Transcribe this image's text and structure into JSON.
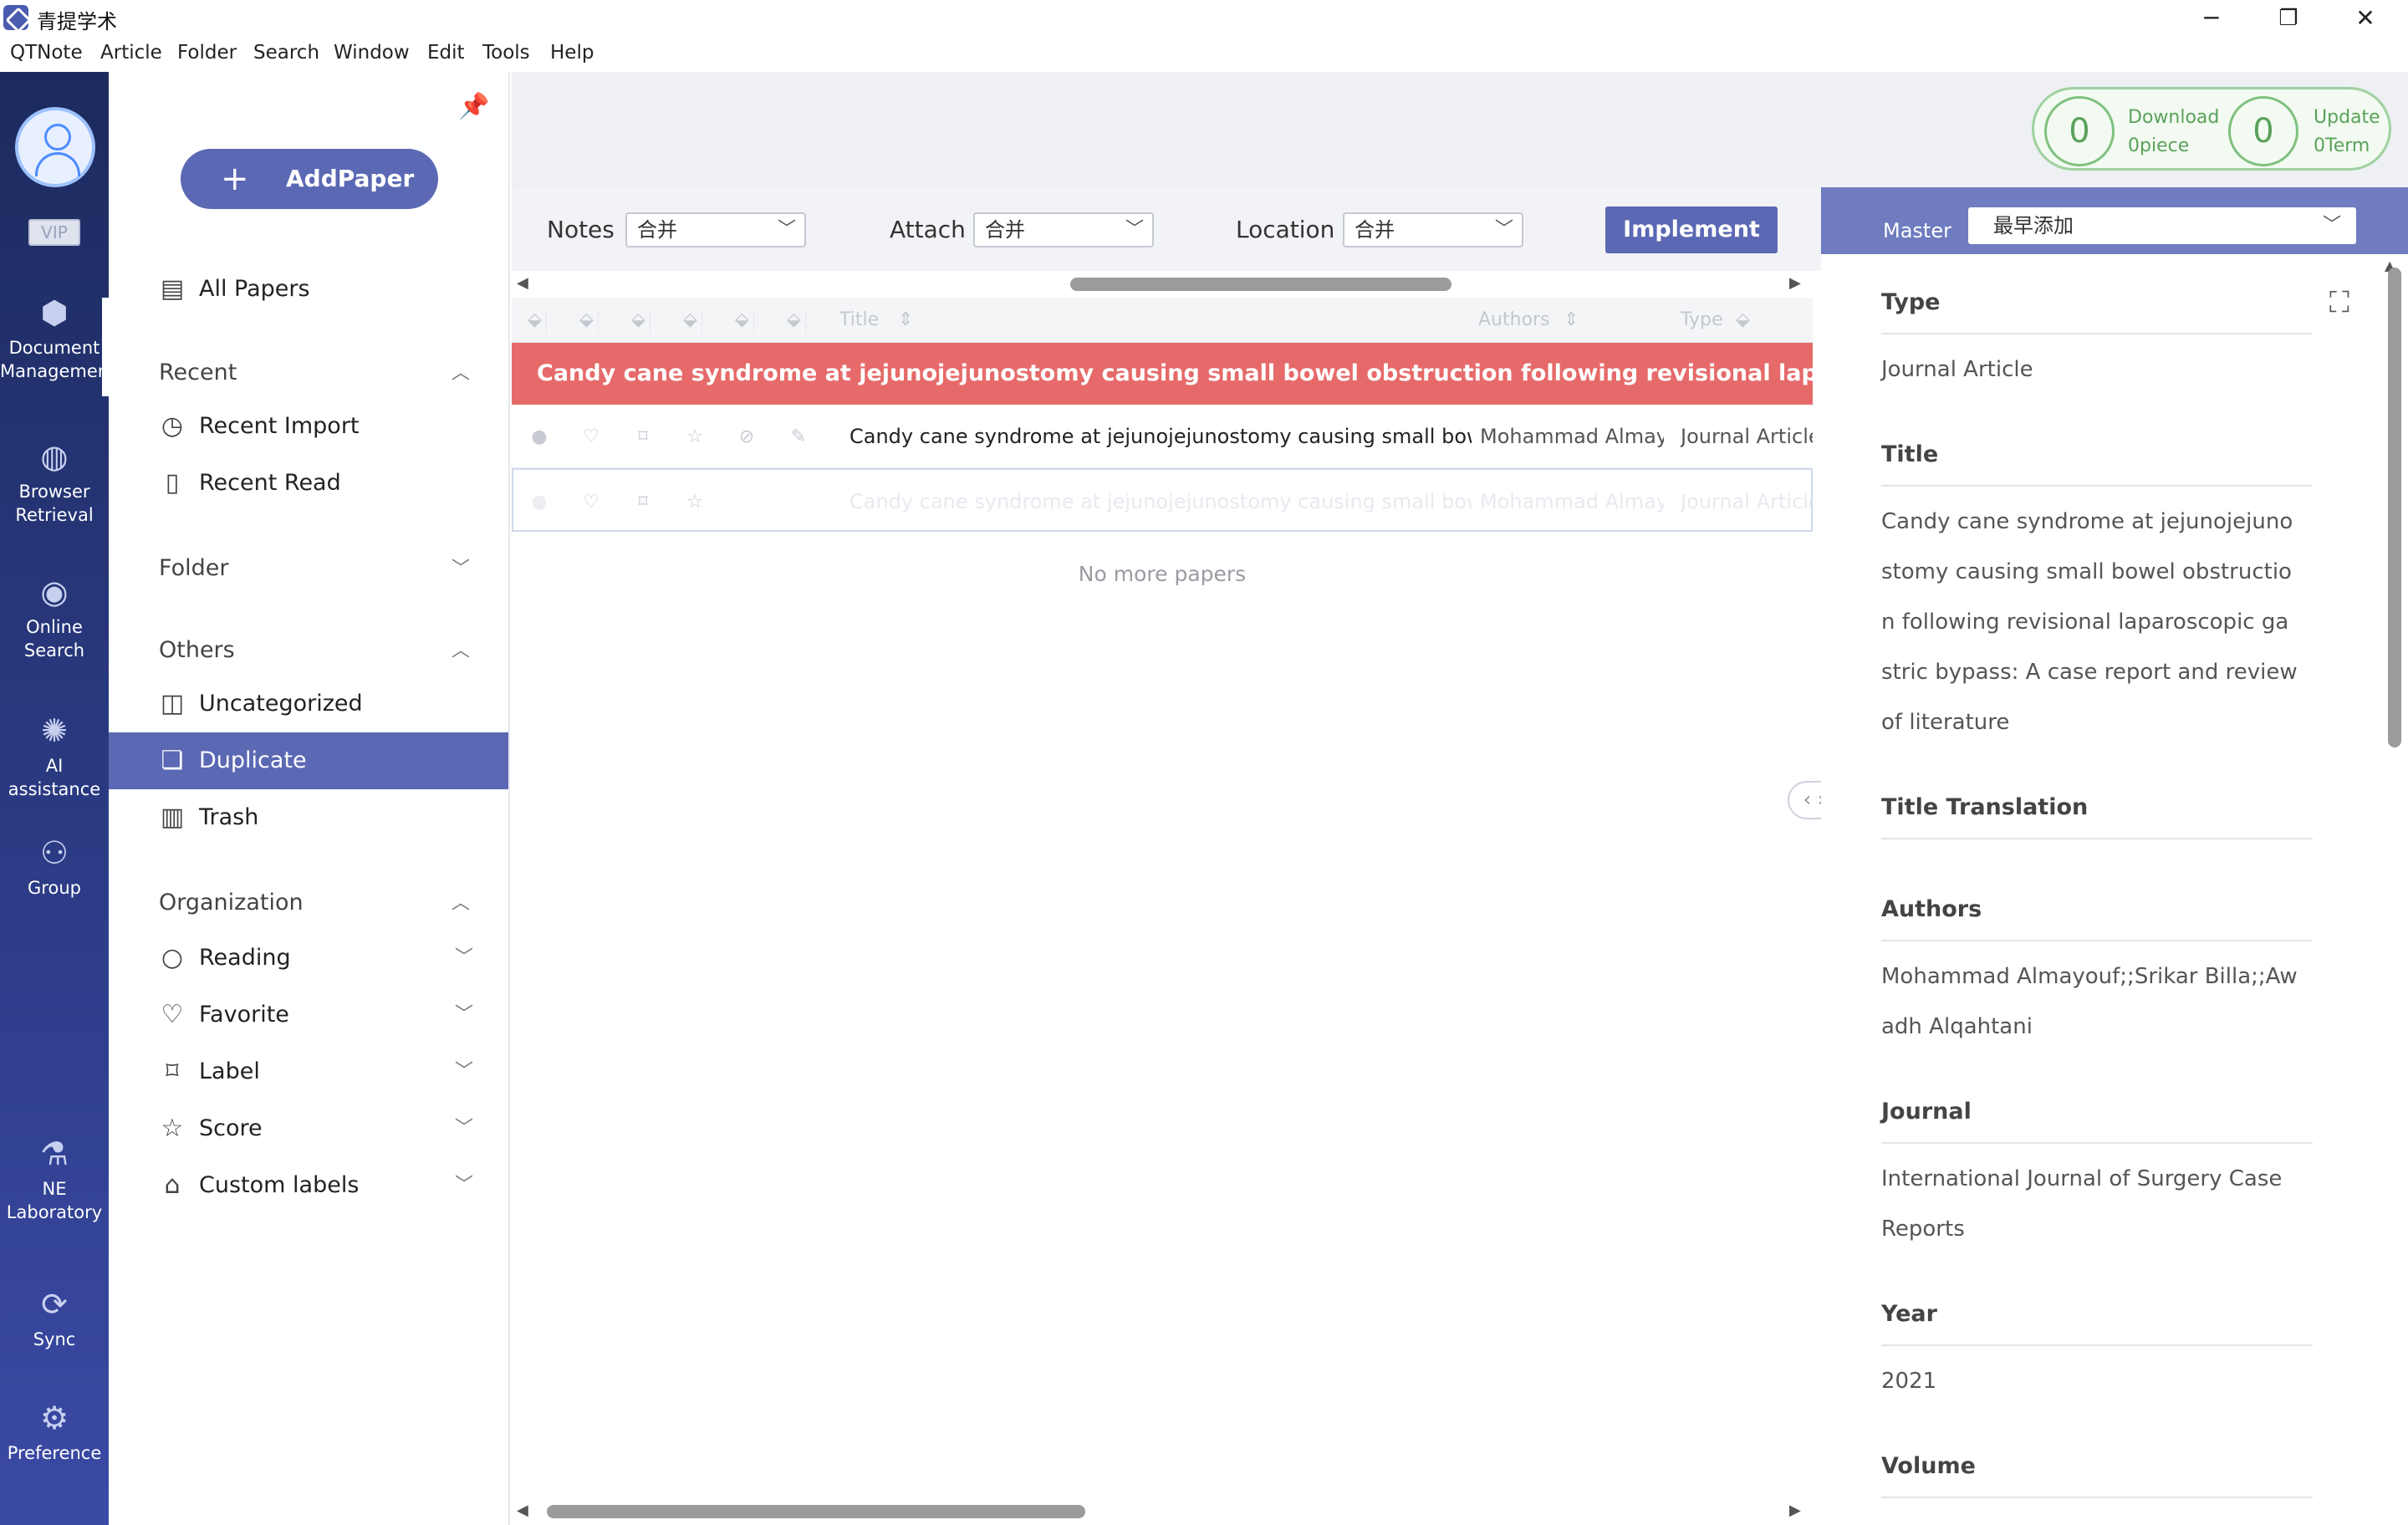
{
  "window": {
    "title": "青提学术",
    "minimize": "─",
    "maximize": "❐",
    "close": "✕"
  },
  "menu": [
    "QTNote",
    "Article",
    "Folder",
    "Search",
    "Window",
    "Edit",
    "Tools",
    "Help"
  ],
  "rail": {
    "vip": "VIP",
    "items": [
      {
        "label1": "Document",
        "label2": "Management",
        "icon": "cube-icon"
      },
      {
        "label1": "Browser",
        "label2": "Retrieval",
        "icon": "globe-icon"
      },
      {
        "label1": "Online",
        "label2": "Search",
        "icon": "eye-icon"
      },
      {
        "label1": "AI assistance",
        "label2": "",
        "icon": "ai-icon"
      },
      {
        "label1": "Group",
        "label2": "",
        "icon": "group-icon"
      },
      {
        "label1": "NE",
        "label2": "Laboratory",
        "icon": "microscope-icon"
      },
      {
        "label1": "Sync",
        "label2": "",
        "icon": "sync-icon"
      },
      {
        "label1": "Preference",
        "label2": "",
        "icon": "gear-icon"
      }
    ]
  },
  "sidebar": {
    "add_paper": "AddPaper",
    "all_papers": "All Papers",
    "recent": "Recent",
    "recent_import": "Recent Import",
    "recent_read": "Recent Read",
    "folder": "Folder",
    "others": "Others",
    "uncategorized": "Uncategorized",
    "duplicate": "Duplicate",
    "trash": "Trash",
    "organization": "Organization",
    "reading": "Reading",
    "favorite": "Favorite",
    "label": "Label",
    "score": "Score",
    "custom_labels": "Custom labels"
  },
  "filters": {
    "notes_label": "Notes",
    "notes_value": "合并",
    "attach_label": "Attach",
    "attach_value": "合并",
    "location_label": "Location",
    "location_value": "合并",
    "implement": "Implement"
  },
  "badges": {
    "download_count": "0",
    "download_label": "Download",
    "download_sub": "0piece",
    "update_count": "0",
    "update_label": "Update",
    "update_sub": "0Term"
  },
  "table": {
    "headers": {
      "title": "Title",
      "authors": "Authors",
      "type": "Type"
    },
    "group_title": "Candy cane syndrome at jejunojejunostomy causing small bowel obstruction following revisional laparoscopic gastric bypass",
    "rows": [
      {
        "title": "Candy cane syndrome at jejunojejunostomy causing small bowel obstruction",
        "authors": "Mohammad Almayouf",
        "type": "Journal Article"
      },
      {
        "title": "Candy cane syndrome at jejunojejunostomy causing small bowel obstruction",
        "authors": "Mohammad Almayouf",
        "type": "Journal Article"
      }
    ],
    "no_more": "No more papers"
  },
  "detail": {
    "master_label": "Master",
    "master_value": "最早添加",
    "fields": {
      "type_label": "Type",
      "type_value": "Journal Article",
      "title_label": "Title",
      "title_value": "Candy cane syndrome at jejunojejunostomy causing small bowel obstruction following revisional laparoscopic gastric bypass: A case report and review of literature",
      "title_translation_label": "Title Translation",
      "authors_label": "Authors",
      "authors_value": "Mohammad Almayouf;;Srikar Billa;;Awadh Alqahtani",
      "journal_label": "Journal",
      "journal_value": "International Journal of Surgery Case Reports",
      "year_label": "Year",
      "year_value": "2021",
      "volume_label": "Volume"
    }
  }
}
